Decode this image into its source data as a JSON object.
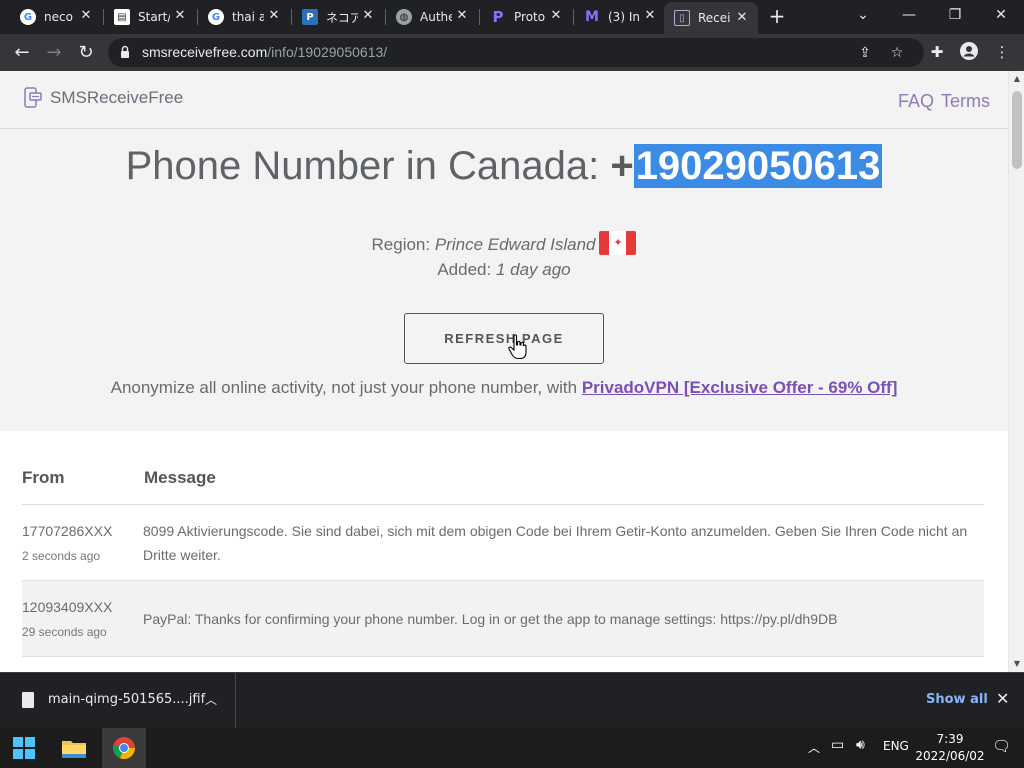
{
  "browser": {
    "tabs": [
      {
        "title": "neco",
        "favicon": "google-g",
        "fav_color": "#ffffff",
        "active": false
      },
      {
        "title": "Start/",
        "favicon": "page",
        "fav_color": "#ffffff",
        "active": false
      },
      {
        "title": "thai a",
        "favicon": "google-g",
        "fav_color": "#ffffff",
        "active": false
      },
      {
        "title": "ネコア",
        "favicon": "p-square",
        "fav_color": "#2f6fb3",
        "active": false
      },
      {
        "title": "Authe",
        "favicon": "globe",
        "fav_color": "#e8eaed",
        "active": false
      },
      {
        "title": "Proto",
        "favicon": "proton-p",
        "fav_color": "#6d4aff",
        "active": false
      },
      {
        "title": "(3) In",
        "favicon": "proton-m",
        "fav_color": "#6d4aff",
        "active": false
      },
      {
        "title": "Recei",
        "favicon": "sms-logo",
        "fav_color": "#8f7bb7",
        "active": true
      }
    ],
    "url_domain": "smsreceivefree.com",
    "url_path": "/info/19029050613/"
  },
  "site": {
    "logo_text": "SMSReceiveFree",
    "nav": {
      "faq": "FAQ",
      "terms": "Terms"
    }
  },
  "hero": {
    "title_prefix": "Phone Number in Canada: ",
    "plus": "+",
    "number": "19029050613",
    "region_label": "Region: ",
    "region_value": "Prince Edward Island",
    "added_label": "Added: ",
    "added_value": "1 day ago",
    "refresh_label": "REFRESH PAGE",
    "promo_text": "Anonymize all online activity, not just your phone number, with ",
    "promo_link": "PrivadoVPN [Exclusive Offer - 69% Off]"
  },
  "messages": {
    "headers": {
      "from": "From",
      "message": "Message"
    },
    "rows": [
      {
        "from": "17707286XXX",
        "time": "2 seconds ago",
        "text": "8099 Aktivierungscode. Sie sind dabei, sich mit dem obigen Code bei Ihrem Getir-Konto anzumelden. Geben Sie Ihren Code nicht an Dritte weiter."
      },
      {
        "from": "12093409XXX",
        "time": "29 seconds ago",
        "text": "PayPal: Thanks for confirming your phone number. Log in or get the app to manage settings: https://py.pl/dh9DB"
      }
    ]
  },
  "downloads": {
    "file_name": "main-qimg-501565....jfif",
    "show_all": "Show all"
  },
  "taskbar": {
    "lang": "ENG",
    "time": "7:39",
    "date": "2022/06/02"
  },
  "colors": {
    "accent": "#8f7bb7",
    "highlight": "#3c8ce6",
    "link": "#7b4fb8"
  }
}
